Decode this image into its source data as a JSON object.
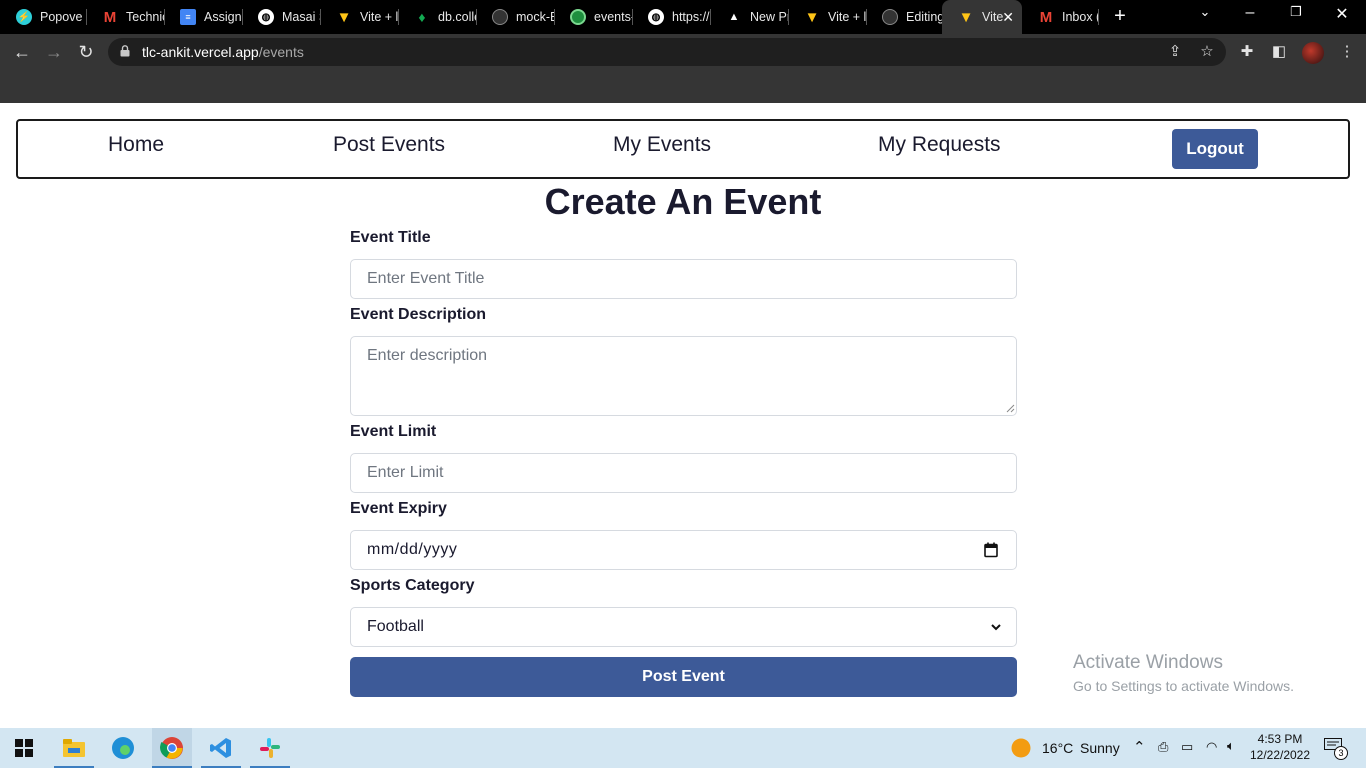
{
  "browser": {
    "tabs": [
      {
        "label": "Popove",
        "icon": "lightning-icon"
      },
      {
        "label": "Technic",
        "icon": "gmail-icon"
      },
      {
        "label": "Assignm",
        "icon": "docs-icon"
      },
      {
        "label": "Masai S",
        "icon": "globe-icon"
      },
      {
        "label": "Vite + l",
        "icon": "vite-icon"
      },
      {
        "label": "db.colle",
        "icon": "mongodb-icon"
      },
      {
        "label": "mock-E",
        "icon": "github-icon"
      },
      {
        "label": "events-",
        "icon": "app-icon"
      },
      {
        "label": "https://",
        "icon": "globe-icon"
      },
      {
        "label": "New Pr",
        "icon": "vercel-icon"
      },
      {
        "label": "Vite + l",
        "icon": "vite-icon"
      },
      {
        "label": "Editing",
        "icon": "github-icon"
      },
      {
        "label": "Vite",
        "icon": "vite-icon",
        "active": true
      },
      {
        "label": "Inbox (",
        "icon": "gmail-icon"
      }
    ],
    "new_tab_symbol": "+",
    "url_host": "tlc-ankit.vercel.app",
    "url_path": "/events",
    "colors": {
      "tabstrip": "#000000",
      "toolbar": "#353535"
    }
  },
  "navbar": {
    "links": [
      "Home",
      "Post Events",
      "My Events",
      "My Requests"
    ],
    "logout_label": "Logout",
    "accent": "#3d5a98"
  },
  "form": {
    "title": "Create An Event",
    "title_label": "Event Title",
    "title_placeholder": "Enter Event Title",
    "description_label": "Event Description",
    "description_placeholder": "Enter description",
    "limit_label": "Event Limit",
    "limit_placeholder": "Enter Limit",
    "expiry_label": "Event Expiry",
    "expiry_value": "mm/dd/yyyy",
    "category_label": "Sports Category",
    "category_value": "Football",
    "submit_label": "Post Event"
  },
  "watermark": {
    "line1": "Activate Windows",
    "line2": "Go to Settings to activate Windows."
  },
  "taskbar": {
    "weather_temp": "16°C",
    "weather_desc": "Sunny",
    "time": "4:53 PM",
    "date": "12/22/2022",
    "notification_count": "3"
  }
}
